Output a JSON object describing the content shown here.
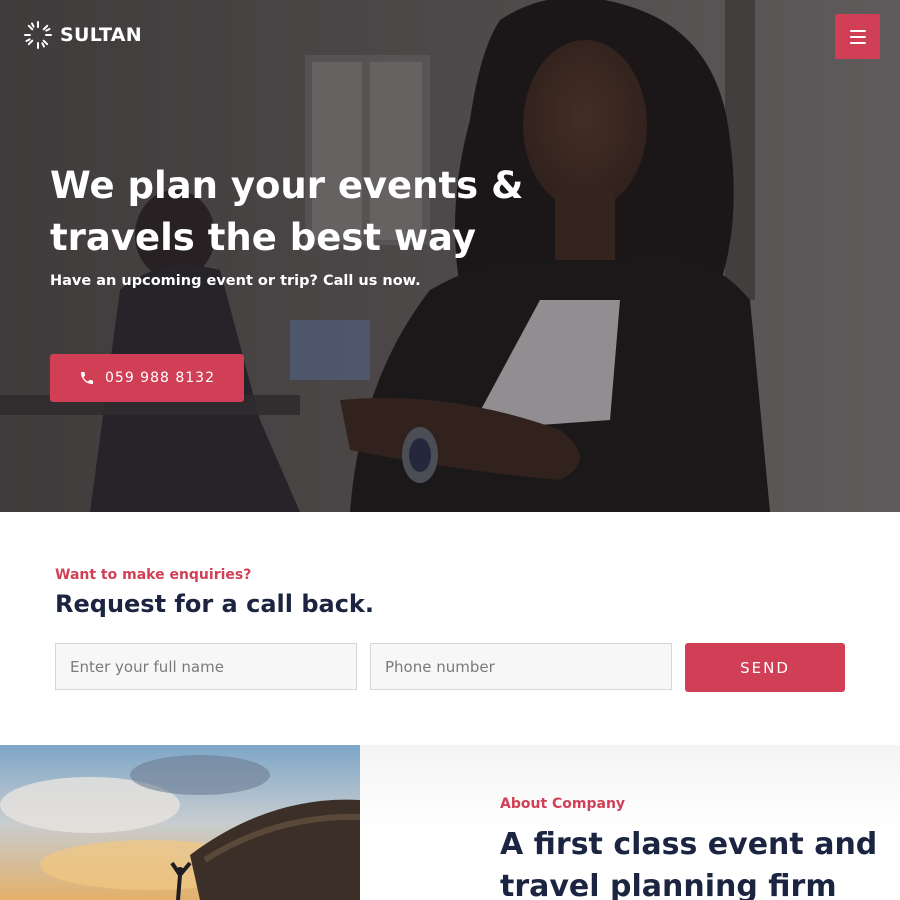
{
  "brand": {
    "name": "SULTAN"
  },
  "nav": {
    "menu_icon": "hamburger-icon"
  },
  "hero": {
    "title_line1": "We plan your events &",
    "title_line2": "travels the best way",
    "subtitle": "Have an upcoming event or trip? Call us now.",
    "phone_icon": "phone-icon",
    "phone": "059 988 8132"
  },
  "enquiry": {
    "kicker": "Want to make enquiries?",
    "title": "Request for a call back.",
    "name_placeholder": "Enter your full name",
    "phone_placeholder": "Phone number",
    "send_label": "SEND"
  },
  "about": {
    "kicker": "About Company",
    "title_line1": "A first class event and",
    "title_line2": "travel planning firm"
  },
  "colors": {
    "accent": "#d13f56",
    "heading": "#1b2541"
  }
}
